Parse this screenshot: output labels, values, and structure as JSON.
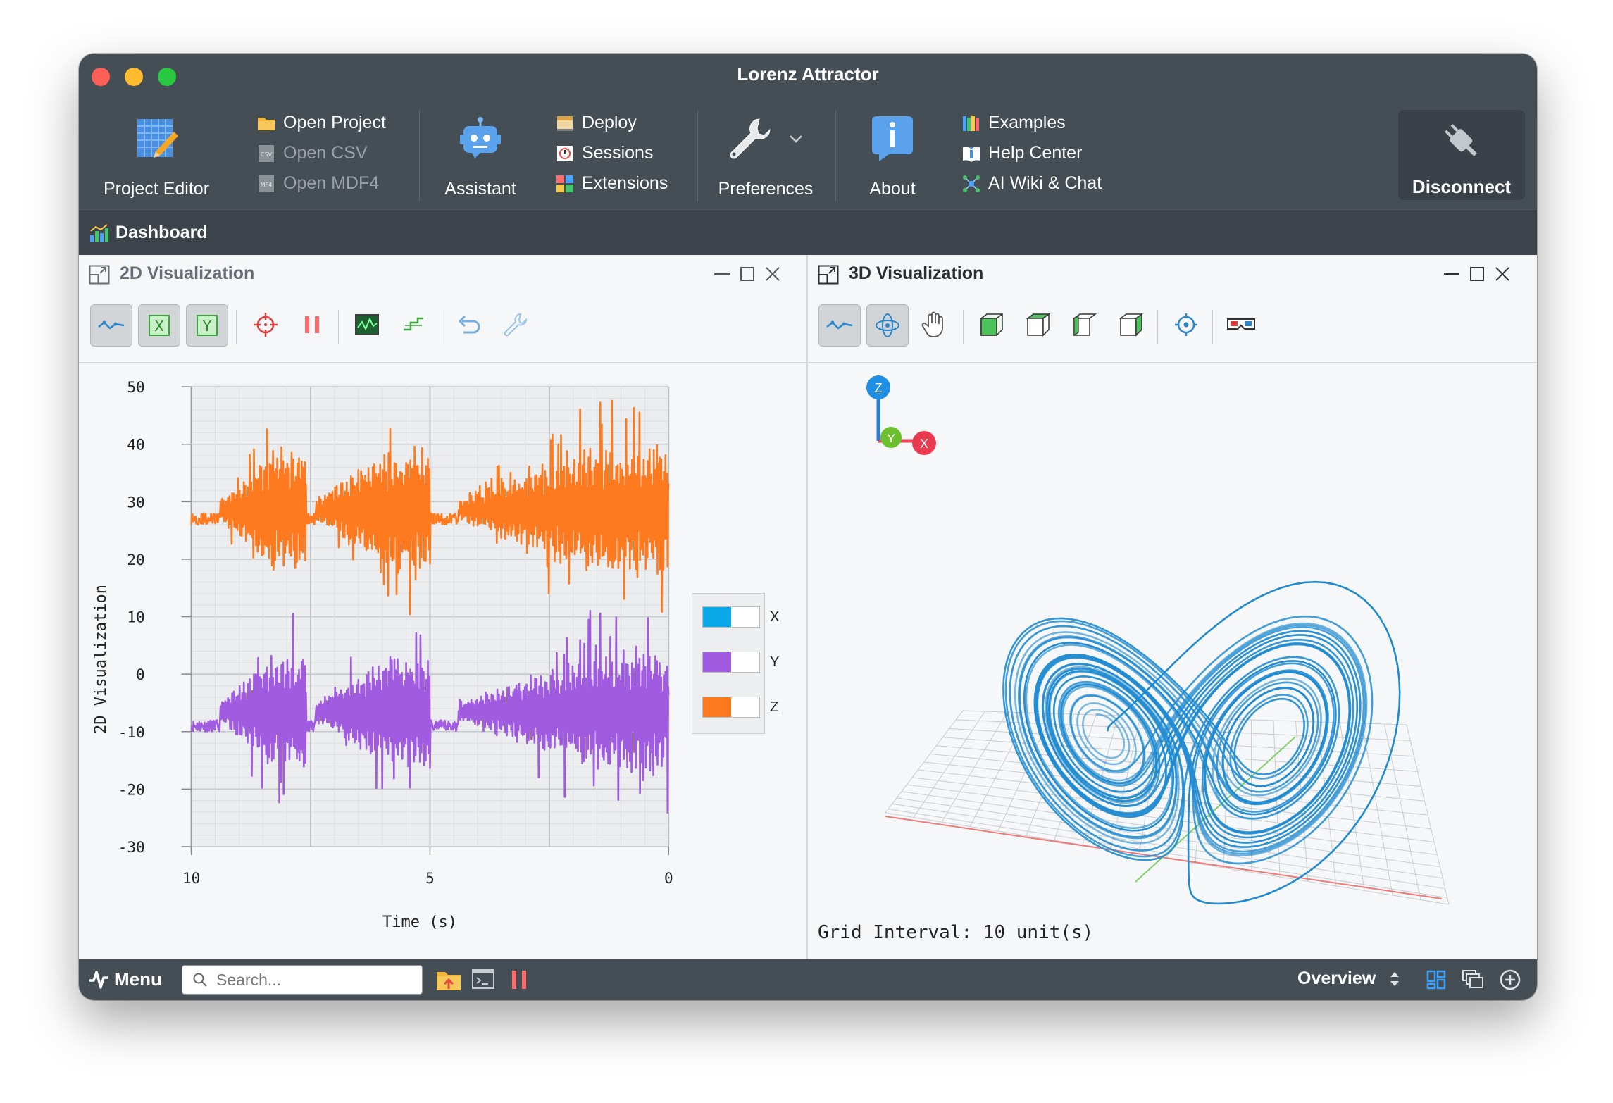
{
  "window": {
    "title": "Lorenz Attractor"
  },
  "toolbar": {
    "project_editor": "Project Editor",
    "open_project": "Open Project",
    "open_csv": "Open CSV",
    "open_mdf4": "Open MDF4",
    "assistant": "Assistant",
    "deploy": "Deploy",
    "sessions": "Sessions",
    "extensions": "Extensions",
    "preferences": "Preferences",
    "about": "About",
    "examples": "Examples",
    "help_center": "Help Center",
    "ai_wiki_chat": "AI Wiki & Chat",
    "disconnect": "Disconnect"
  },
  "dashboard": {
    "title": "Dashboard"
  },
  "pane2d": {
    "title": "2D Visualization",
    "buttons": [
      {
        "name": "plot-line-icon",
        "active": true
      },
      {
        "name": "x-toggle-icon",
        "active": true
      },
      {
        "name": "y-toggle-icon",
        "active": true
      },
      {
        "name": "crosshair-icon",
        "active": false
      },
      {
        "name": "pause-icon",
        "active": false
      },
      {
        "name": "oscilloscope-icon",
        "active": false
      },
      {
        "name": "interpolate-icon",
        "active": false
      },
      {
        "name": "undo-icon",
        "active": false
      },
      {
        "name": "wrench-icon",
        "active": false
      }
    ],
    "x_button_label": "X",
    "y_button_label": "Y"
  },
  "chart_data": {
    "type": "line",
    "title": "",
    "xlabel": "Time (s)",
    "ylabel": "2D Visualization",
    "xlim": [
      10,
      0
    ],
    "ylim": [
      -30,
      50
    ],
    "x_ticks": [
      "10",
      "5",
      "0"
    ],
    "y_ticks": [
      "50",
      "40",
      "30",
      "20",
      "10",
      "0",
      "-10",
      "-20",
      "-30"
    ],
    "grid": true,
    "legend_position": "right",
    "series": [
      {
        "name": "X",
        "color": "#0aa8e8",
        "visible": false
      },
      {
        "name": "Y",
        "color": "#a15be0",
        "baseline": -9,
        "bursts": [
          [
            9.4,
            7.6
          ],
          [
            7.4,
            5.0
          ],
          [
            4.4,
            0.0
          ]
        ],
        "range": [
          -25,
          12
        ]
      },
      {
        "name": "Z",
        "color": "#ff7a1e",
        "baseline": 27,
        "bursts": [
          [
            9.4,
            7.6
          ],
          [
            7.4,
            5.0
          ],
          [
            4.4,
            0.0
          ]
        ],
        "range": [
          8,
          49
        ]
      }
    ]
  },
  "pane3d": {
    "title": "3D Visualization",
    "buttons": [
      {
        "name": "plot-line-icon",
        "active": true
      },
      {
        "name": "orbit-icon",
        "active": true
      },
      {
        "name": "pan-hand-icon",
        "active": false
      },
      {
        "name": "view-front-icon",
        "active": false
      },
      {
        "name": "view-top-icon",
        "active": false
      },
      {
        "name": "view-side-icon",
        "active": false
      },
      {
        "name": "view-iso-icon",
        "active": false
      },
      {
        "name": "center-icon",
        "active": false
      },
      {
        "name": "stereo-glasses-icon",
        "active": false
      }
    ],
    "axis_labels": {
      "z": "Z",
      "y": "Y",
      "x": "X"
    },
    "grid_interval": "Grid Interval: 10 unit(s)",
    "attractor_color": "#1f8ad0"
  },
  "statusbar": {
    "menu": "Menu",
    "search_placeholder": "Search...",
    "overview": "Overview"
  },
  "colors": {
    "toolbar_bg": "#454d55",
    "x_color": "#0aa8e8",
    "y_color": "#a15be0",
    "z_color": "#ff7a1e"
  }
}
